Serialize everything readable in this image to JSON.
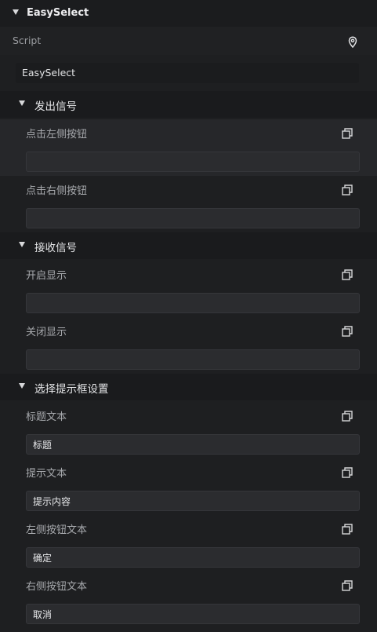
{
  "component": {
    "title": "EasySelect",
    "script_label": "Script",
    "script_value": "EasySelect"
  },
  "sections": {
    "emit": {
      "title": "发出信号",
      "left_label": "点击左侧按钮",
      "left_value": "",
      "right_label": "点击右侧按钮",
      "right_value": ""
    },
    "receive": {
      "title": "接收信号",
      "open_label": "开启显示",
      "open_value": "",
      "close_label": "关闭显示",
      "close_value": ""
    },
    "settings": {
      "title": "选择提示框设置",
      "title_text_label": "标题文本",
      "title_text_value": "标题",
      "hint_text_label": "提示文本",
      "hint_text_value": "提示内容",
      "left_btn_label": "左侧按钮文本",
      "left_btn_value": "确定",
      "right_btn_label": "右侧按钮文本",
      "right_btn_value": "取消"
    }
  },
  "icons": {
    "collapse": "triangle-down-icon",
    "pin": "location-pin-icon",
    "copy": "copy-icon"
  }
}
